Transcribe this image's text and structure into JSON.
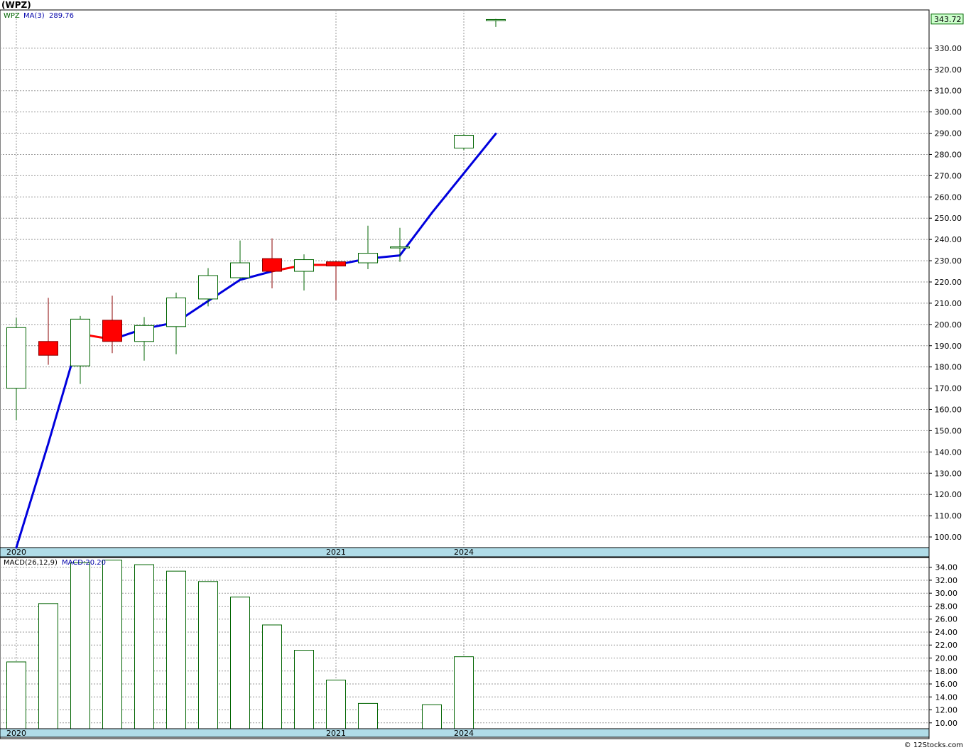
{
  "title": "(WPZ)",
  "watermark": "© 12Stocks.com",
  "colors": {
    "up": "#006400",
    "down": "#ff0000",
    "ma": "#0000dd",
    "axisband": "#b0dce8",
    "grid": "#9a9a9a"
  },
  "chart_data": [
    {
      "type": "candlestick",
      "ticker_label": "WPZ",
      "ma_label": "MA(3)",
      "ma_value_text": "289.76",
      "last_price_text": "343.72",
      "ylim": [
        95,
        348
      ],
      "yticks": [
        "100.00",
        "110.00",
        "120.00",
        "130.00",
        "140.00",
        "150.00",
        "160.00",
        "170.00",
        "180.00",
        "190.00",
        "200.00",
        "210.00",
        "220.00",
        "230.00",
        "240.00",
        "250.00",
        "260.00",
        "270.00",
        "280.00",
        "290.00",
        "300.00",
        "310.00",
        "320.00",
        "330.00"
      ],
      "xlabels": [
        "2020",
        "2021",
        "2024"
      ],
      "candles": [
        {
          "o": 170.0,
          "h": 203.0,
          "l": 155.0,
          "c": 198.5
        },
        {
          "o": 192.0,
          "h": 212.5,
          "l": 181.0,
          "c": 185.5
        },
        {
          "o": 180.5,
          "h": 204.0,
          "l": 172.0,
          "c": 202.5
        },
        {
          "o": 202.0,
          "h": 213.5,
          "l": 186.5,
          "c": 192.0
        },
        {
          "o": 192.0,
          "h": 203.5,
          "l": 183.0,
          "c": 199.5
        },
        {
          "o": 199.0,
          "h": 215.0,
          "l": 186.0,
          "c": 212.5
        },
        {
          "o": 212.0,
          "h": 226.5,
          "l": 208.5,
          "c": 223.0
        },
        {
          "o": 222.0,
          "h": 239.5,
          "l": 221.5,
          "c": 229.0
        },
        {
          "o": 231.0,
          "h": 240.5,
          "l": 217.0,
          "c": 225.0
        },
        {
          "o": 225.0,
          "h": 233.0,
          "l": 216.0,
          "c": 230.5
        },
        {
          "o": 229.5,
          "h": 230.0,
          "l": 211.5,
          "c": 227.5
        },
        {
          "o": 229.0,
          "h": 246.5,
          "l": 226.0,
          "c": 233.5
        },
        {
          "o": 236.0,
          "h": 245.5,
          "l": 229.5,
          "c": 236.5
        },
        null,
        {
          "o": 283.0,
          "h": 289.5,
          "l": 282.0,
          "c": 289.0
        },
        {
          "o": 343.0,
          "h": 343.8,
          "l": 340.0,
          "c": 343.5
        }
      ],
      "ma": [
        95.0,
        144.0,
        195.5,
        193.0,
        198.0,
        201.0,
        211.0,
        221.0,
        225.0,
        228.0,
        228.0,
        231.0,
        232.5,
        252.5,
        null,
        289.76
      ],
      "ma_red_segments": [
        [
          2,
          3
        ],
        [
          8,
          9
        ],
        [
          9,
          10
        ]
      ]
    },
    {
      "type": "bar",
      "label": "MACD(26,12,9)",
      "value_text": "MACD:20.20",
      "ylim": [
        9.1,
        35.5
      ],
      "yticks": [
        "10.00",
        "12.00",
        "14.00",
        "16.00",
        "18.00",
        "20.00",
        "22.00",
        "24.00",
        "26.00",
        "28.00",
        "30.00",
        "32.00",
        "34.00"
      ],
      "xlabels": [
        "2020",
        "2021",
        "2024"
      ],
      "values": [
        19.4,
        28.4,
        34.7,
        35.1,
        34.4,
        33.4,
        31.8,
        29.4,
        25.1,
        21.2,
        16.6,
        13.0,
        null,
        12.8,
        20.2
      ]
    }
  ]
}
